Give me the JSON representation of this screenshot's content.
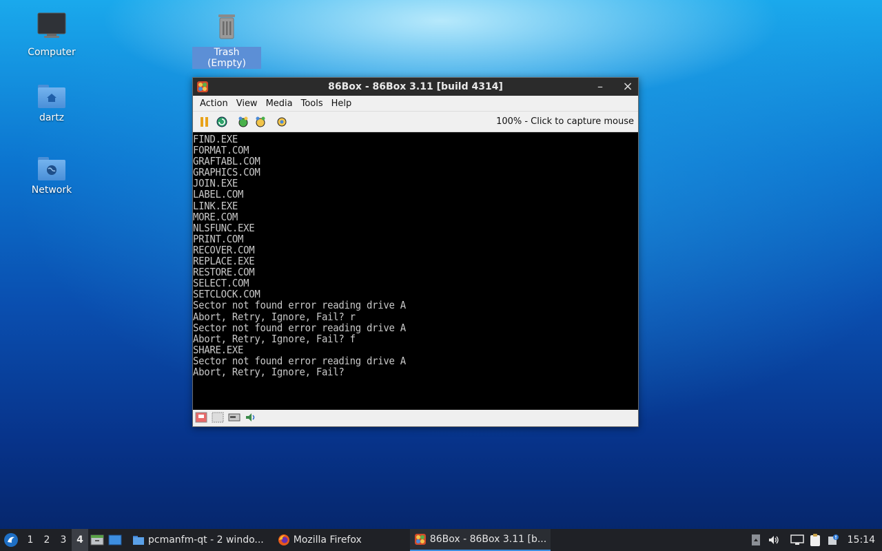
{
  "desktop": {
    "icons": [
      {
        "label": "Computer"
      },
      {
        "label": "Trash (Empty)"
      },
      {
        "label": "dartz"
      },
      {
        "label": "Network"
      }
    ]
  },
  "window": {
    "title": "86Box - 86Box 3.11 [build 4314]",
    "minimize": "–",
    "close": "×",
    "menu": [
      "Action",
      "View",
      "Media",
      "Tools",
      "Help"
    ],
    "status_text": "100% - Click to capture mouse",
    "screen_lines": [
      "FIND.EXE",
      "FORMAT.COM",
      "GRAFTABL.COM",
      "GRAPHICS.COM",
      "JOIN.EXE",
      "LABEL.COM",
      "LINK.EXE",
      "MORE.COM",
      "NLSFUNC.EXE",
      "PRINT.COM",
      "RECOVER.COM",
      "REPLACE.EXE",
      "RESTORE.COM",
      "SELECT.COM",
      "SETCLOCK.COM",
      "",
      "Sector not found error reading drive A",
      "Abort, Retry, Ignore, Fail? r",
      "",
      "Sector not found error reading drive A",
      "Abort, Retry, Ignore, Fail? f",
      "SHARE.EXE",
      "",
      "Sector not found error reading drive A",
      "Abort, Retry, Ignore, Fail?"
    ]
  },
  "taskbar": {
    "workspaces": [
      "1",
      "2",
      "3",
      "4"
    ],
    "active_workspace": "4",
    "tasks": [
      {
        "label": "pcmanfm-qt - 2 windo..."
      },
      {
        "label": "Mozilla Firefox"
      },
      {
        "label": "86Box - 86Box 3.11 [b..."
      }
    ],
    "clock": "15:14"
  }
}
